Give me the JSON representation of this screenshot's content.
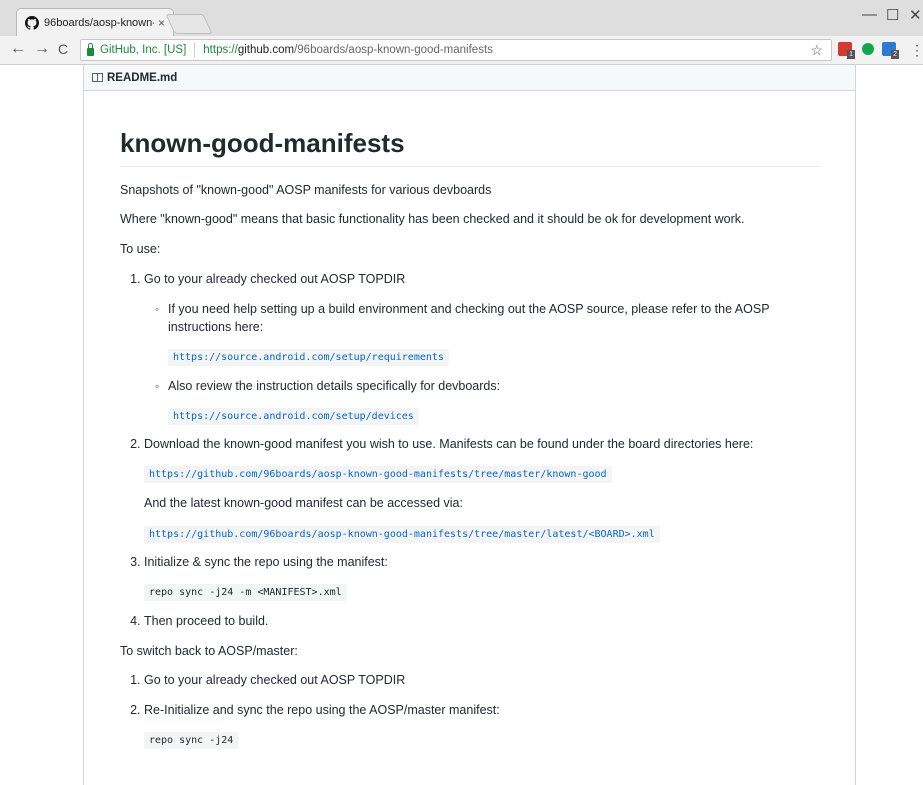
{
  "browser": {
    "tab_title": "96boards/aosp-known-g",
    "tab_close": "×",
    "window_min": "—",
    "window_max": "☐",
    "window_close": "✕",
    "back": "←",
    "forward": "→",
    "reload": "C",
    "security_label": "GitHub, Inc. [US]",
    "url_scheme": "https://",
    "url_host": "github.com",
    "url_path": "/96boards/aosp-known-good-manifests",
    "bookmark_star": "☆",
    "ext1_badge": "1",
    "ext3_badge": "2",
    "menu": "⋮",
    "colors": {
      "secure": "#1a8a3a",
      "link": "#0366d6"
    }
  },
  "readme": {
    "header": "README.md",
    "title": "known-good-manifests",
    "intro": "Snapshots of \"known-good\" AOSP manifests for various devboards",
    "definition": "Where \"known-good\" means that basic functionality has been checked and it should be ok for development work.",
    "to_use": "To use:",
    "steps": {
      "s1": "Go to your already checked out AOSP TOPDIR",
      "s1_sub1": "If you need help setting up a build environment and checking out the AOSP source, please refer to the AOSP instructions here:",
      "s1_sub1_code": "https://source.android.com/setup/requirements",
      "s1_sub2": "Also review the instruction details specifically for devboards:",
      "s1_sub2_code": "https://source.android.com/setup/devices",
      "s2": "Download the known-good manifest you wish to use. Manifests can be found under the board directories here:",
      "s2_code": "https://github.com/96boards/aosp-known-good-manifests/tree/master/known-good",
      "s2_more": "And the latest known-good manifest can be accessed via:",
      "s2_code2": "https://github.com/96boards/aosp-known-good-manifests/tree/master/latest/<BOARD>.xml",
      "s3": "Initialize & sync the repo using the manifest:",
      "s3_code": "repo sync -j24 -m <MANIFEST>.xml",
      "s4": "Then proceed to build."
    },
    "switch_back": "To switch back to AOSP/master:",
    "switch_steps": {
      "s1": "Go to your already checked out AOSP TOPDIR",
      "s2": "Re-Initialize and sync the repo using the AOSP/master manifest:",
      "s2_code": "repo sync -j24"
    }
  }
}
